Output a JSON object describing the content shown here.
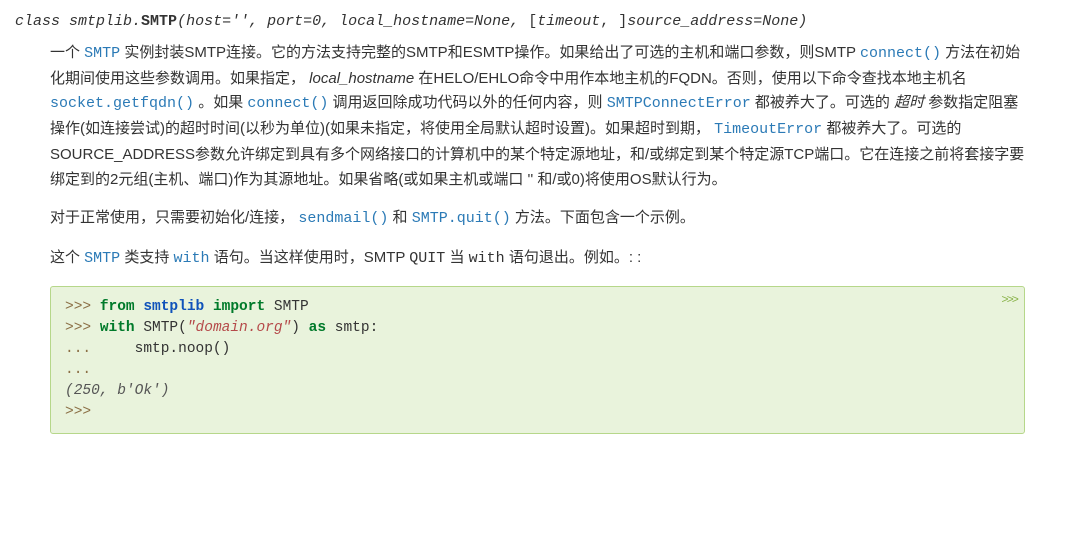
{
  "signature": {
    "keyword": "class",
    "prefix": "smtplib.",
    "classname": "SMTP",
    "params_1": "host=''",
    "params_2": "port=0",
    "params_3": "local_hostname=None",
    "params_4": "timeout",
    "params_5": "source_address=None"
  },
  "links": {
    "SMTP": "SMTP",
    "connect": "connect()",
    "getfqdn": "socket.getfqdn()",
    "SMTPConnectError": "SMTPConnectError",
    "TimeoutError": "TimeoutError",
    "sendmail": "sendmail()",
    "quit": "SMTP.quit()",
    "with": "with"
  },
  "text": {
    "p1a": "一个 ",
    "p1b": " 实例封装SMTP连接。它的方法支持完整的SMTP和ESMTP操作。如果给出了可选的主机和端口参数，则SMTP ",
    "p1c": " 方法在初始化期间使用这些参数调用。如果指定， ",
    "p1c_ital": "local_hostname",
    "p1d": " 在HELO/EHLO命令中用作本地主机的FQDN。否则，使用以下命令查找本地主机名 ",
    "p1e": " 。如果 ",
    "p1f": " 调用返回除成功代码以外的任何内容，则 ",
    "p1g": " 都被养大了。可选的 ",
    "p1g_ital": "超时",
    "p1h": " 参数指定阻塞操作(如连接尝试)的超时时间(以秒为单位)(如果未指定，将使用全局默认超时设置)。如果超时到期， ",
    "p1i": " 都被养大了。可选的SOURCE_ADDRESS参数允许绑定到具有多个网络接口的计算机中的某个特定源地址，和/或绑定到某个特定源TCP端口。它在连接之前将套接字要绑定到的2元组(主机、端口)作为其源地址。如果省略(或如果主机或端口 ''  和/或0)将使用OS默认行为。",
    "p2a": "对于正常使用，只需要初始化/连接， ",
    "p2b": " 和 ",
    "p2c": " 方法。下面包含一个示例。",
    "p3a": "这个 ",
    "p3b": " 类支持 ",
    "p3c": " 语句。当这样使用时，SMTP ",
    "p3c_mono": "QUIT",
    "p3d": " 当 ",
    "p3d_mono": "with",
    "p3e": " 语句退出。例如。: :"
  },
  "code": {
    "prompt": ">>> ",
    "cont": "... ",
    "from": "from",
    "import": "import",
    "with": "with",
    "as": "as",
    "mod": "smtplib",
    "cls": "SMTP",
    "str": "\"domain.org\"",
    "var": "smtp",
    "call": "    smtp.noop()",
    "out": "(250, b'Ok')",
    "prompt_end": ">>>",
    "chev": ">>>"
  }
}
